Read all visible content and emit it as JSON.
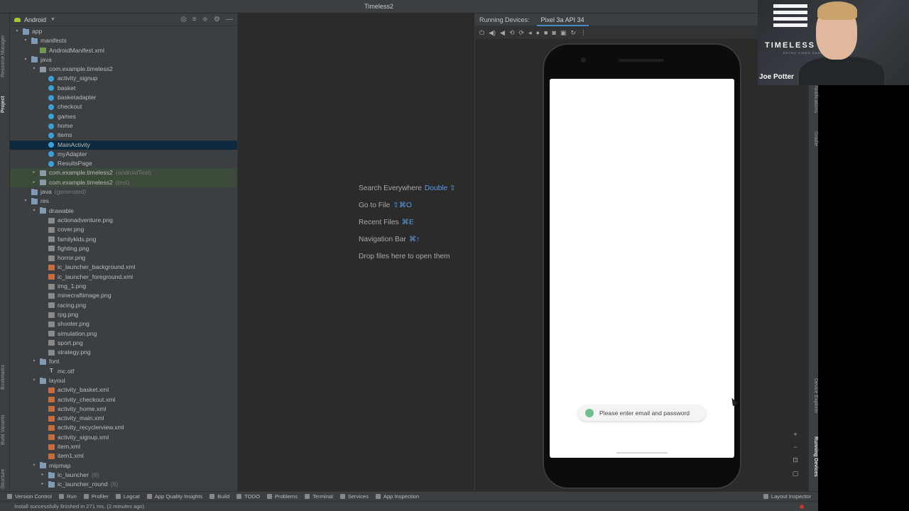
{
  "window": {
    "title": "Timeless2"
  },
  "left_strip": {
    "tabs": [
      "Resource Manager",
      "Project",
      "Bookmarks",
      "Build Variants",
      "Structure"
    ]
  },
  "project_panel": {
    "view_selector": "Android",
    "tree": [
      {
        "label": "app",
        "depth": 0,
        "icon": "folder",
        "arrow": "▾"
      },
      {
        "label": "manifests",
        "depth": 1,
        "icon": "folder",
        "arrow": "▾"
      },
      {
        "label": "AndroidManifest.xml",
        "depth": 2,
        "icon": "manifest"
      },
      {
        "label": "java",
        "depth": 1,
        "icon": "folder",
        "arrow": "▾"
      },
      {
        "label": "com.example.timeless2",
        "depth": 2,
        "icon": "pkg",
        "arrow": "▾"
      },
      {
        "label": "activity_signup",
        "depth": 3,
        "icon": "class"
      },
      {
        "label": "basket",
        "depth": 3,
        "icon": "class"
      },
      {
        "label": "basketadapter",
        "depth": 3,
        "icon": "class"
      },
      {
        "label": "checkout",
        "depth": 3,
        "icon": "class"
      },
      {
        "label": "games",
        "depth": 3,
        "icon": "class"
      },
      {
        "label": "home",
        "depth": 3,
        "icon": "class"
      },
      {
        "label": "items",
        "depth": 3,
        "icon": "class"
      },
      {
        "label": "MainActivity",
        "depth": 3,
        "icon": "class",
        "state": "selected"
      },
      {
        "label": "myAdapter",
        "depth": 3,
        "icon": "class"
      },
      {
        "label": "ResultsPage",
        "depth": 3,
        "icon": "class"
      },
      {
        "label": "com.example.timeless2",
        "hint": "(androidTest)",
        "depth": 2,
        "icon": "pkg",
        "arrow": "▸",
        "state": "green"
      },
      {
        "label": "com.example.timeless2",
        "hint": "(test)",
        "depth": 2,
        "icon": "pkg",
        "arrow": "▸",
        "state": "green"
      },
      {
        "label": "java",
        "hint": "(generated)",
        "depth": 1,
        "icon": "folder"
      },
      {
        "label": "res",
        "depth": 1,
        "icon": "folder",
        "arrow": "▾"
      },
      {
        "label": "drawable",
        "depth": 2,
        "icon": "folder",
        "arrow": "▾"
      },
      {
        "label": "actionadventure.png",
        "depth": 3,
        "icon": "img"
      },
      {
        "label": "cover.png",
        "depth": 3,
        "icon": "img"
      },
      {
        "label": "familykids.png",
        "depth": 3,
        "icon": "img"
      },
      {
        "label": "fighting.png",
        "depth": 3,
        "icon": "img"
      },
      {
        "label": "horror.png",
        "depth": 3,
        "icon": "img"
      },
      {
        "label": "ic_launcher_background.xml",
        "depth": 3,
        "icon": "xml"
      },
      {
        "label": "ic_launcher_foreground.xml",
        "depth": 3,
        "icon": "xml"
      },
      {
        "label": "img_1.png",
        "depth": 3,
        "icon": "img"
      },
      {
        "label": "minecraftimage.png",
        "depth": 3,
        "icon": "img"
      },
      {
        "label": "racing.png",
        "depth": 3,
        "icon": "img"
      },
      {
        "label": "rpg.png",
        "depth": 3,
        "icon": "img"
      },
      {
        "label": "shooter.png",
        "depth": 3,
        "icon": "img"
      },
      {
        "label": "simulation.png",
        "depth": 3,
        "icon": "img"
      },
      {
        "label": "sport.png",
        "depth": 3,
        "icon": "img"
      },
      {
        "label": "strategy.png",
        "depth": 3,
        "icon": "img"
      },
      {
        "label": "font",
        "depth": 2,
        "icon": "folder",
        "arrow": "▾"
      },
      {
        "label": "mc.otf",
        "depth": 3,
        "icon": "font"
      },
      {
        "label": "layout",
        "depth": 2,
        "icon": "folder",
        "arrow": "▾"
      },
      {
        "label": "activity_basket.xml",
        "depth": 3,
        "icon": "xml"
      },
      {
        "label": "activity_checkout.xml",
        "depth": 3,
        "icon": "xml"
      },
      {
        "label": "activity_home.xml",
        "depth": 3,
        "icon": "xml"
      },
      {
        "label": "activity_main.xml",
        "depth": 3,
        "icon": "xml"
      },
      {
        "label": "activity_recyclerview.xml",
        "depth": 3,
        "icon": "xml"
      },
      {
        "label": "activity_signup.xml",
        "depth": 3,
        "icon": "xml"
      },
      {
        "label": "item.xml",
        "depth": 3,
        "icon": "xml"
      },
      {
        "label": "item1.xml",
        "depth": 3,
        "icon": "xml"
      },
      {
        "label": "mipmap",
        "depth": 2,
        "icon": "folder",
        "arrow": "▾"
      },
      {
        "label": "ic_launcher",
        "hint": "(6)",
        "depth": 3,
        "icon": "folder",
        "arrow": "▸"
      },
      {
        "label": "ic_launcher_round",
        "hint": "(6)",
        "depth": 3,
        "icon": "folder",
        "arrow": "▸"
      }
    ]
  },
  "editor_hints": [
    {
      "label": "Search Everywhere",
      "key": "Double ⇧"
    },
    {
      "label": "Go to File",
      "key": "⇧⌘O"
    },
    {
      "label": "Recent Files",
      "key": "⌘E"
    },
    {
      "label": "Navigation Bar",
      "key": "⌘↑"
    },
    {
      "label": "Drop files here to open them",
      "key": ""
    }
  ],
  "running_devices": {
    "label": "Running Devices:",
    "tab": "Pixel 3a API 34",
    "toast": "Please enter email and password"
  },
  "right_strip": {
    "tabs": [
      "Notifications",
      "Gradle",
      "Device Explorer",
      "Running Devices"
    ]
  },
  "bottom_tools": [
    "Version Control",
    "Run",
    "Profiler",
    "Logcat",
    "App Quality Insights",
    "Build",
    "TODO",
    "Problems",
    "Terminal",
    "Services",
    "App Inspection"
  ],
  "bottom_right_tool": "Layout Inspector",
  "status": "Install successfully finished in 271 ms. (2 minutes ago)",
  "webcam": {
    "brand": "TIMELESS",
    "tagline": "RETRO VIDEO GAMES",
    "name": "Joe Potter"
  },
  "colors": {
    "selected_row": "#0d293e",
    "green_row": "#3b4a39",
    "accent": "#4a88c7"
  }
}
